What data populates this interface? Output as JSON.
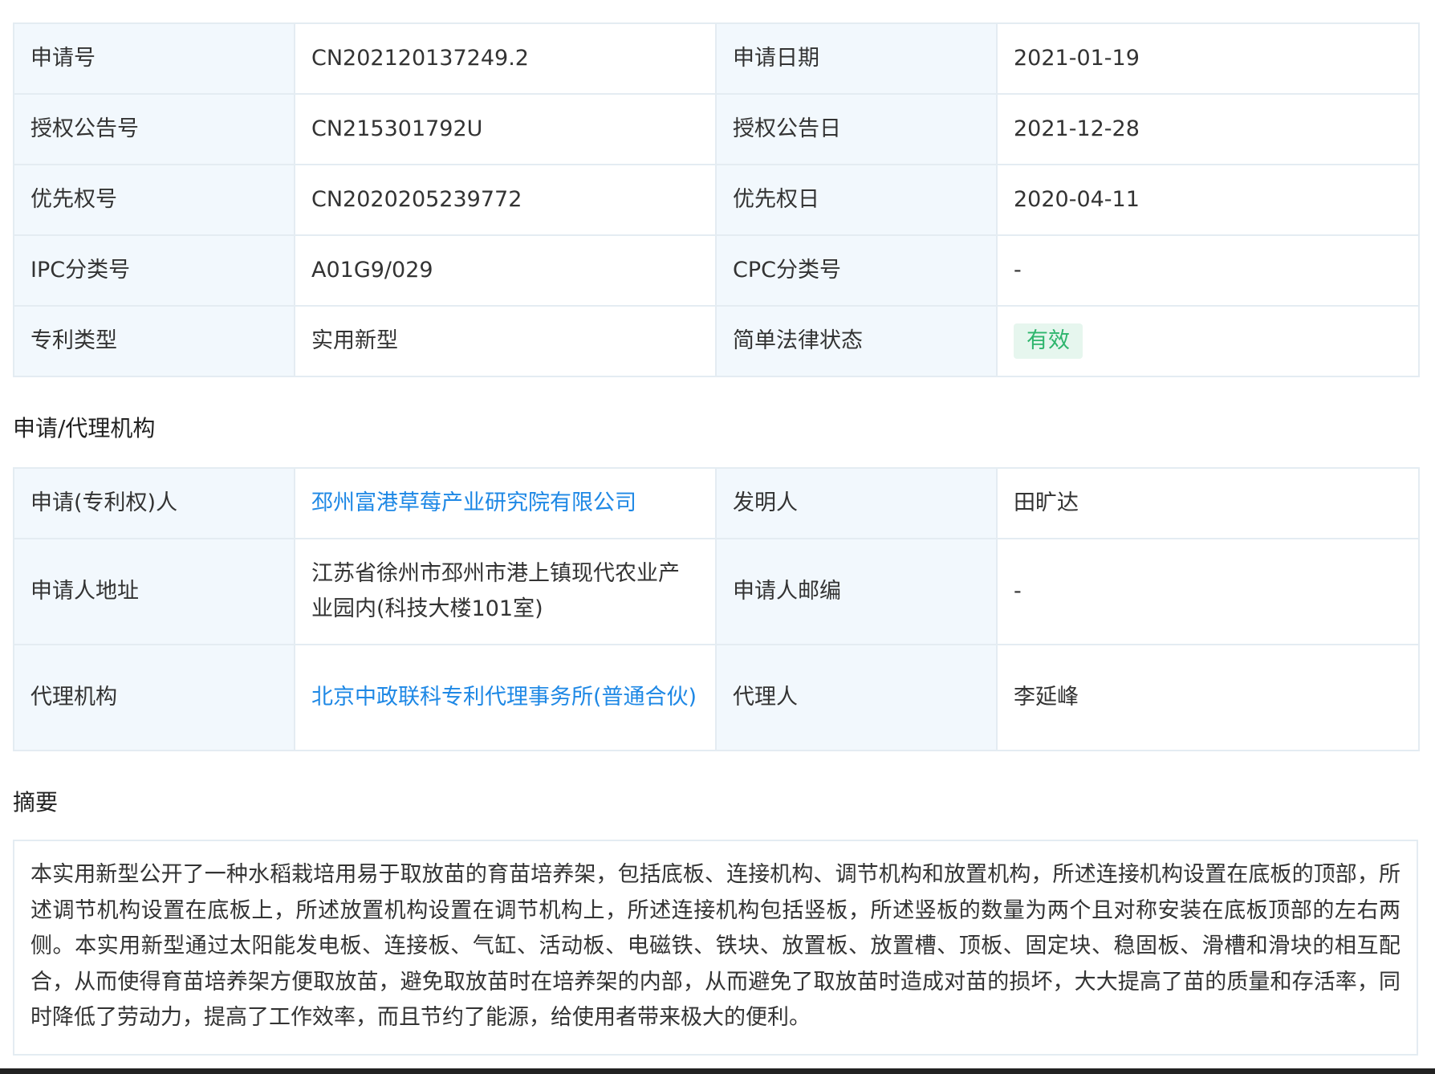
{
  "basic": {
    "rows": [
      {
        "k1": "申请号",
        "v1": "CN202120137249.2",
        "k2": "申请日期",
        "v2": "2021-01-19"
      },
      {
        "k1": "授权公告号",
        "v1": "CN215301792U",
        "k2": "授权公告日",
        "v2": "2021-12-28"
      },
      {
        "k1": "优先权号",
        "v1": "CN2020205239772",
        "k2": "优先权日",
        "v2": "2020-04-11"
      },
      {
        "k1": "IPC分类号",
        "v1": "A01G9/029",
        "k2": "CPC分类号",
        "v2": "-"
      },
      {
        "k1": "专利类型",
        "v1": "实用新型",
        "k2": "简单法律状态",
        "v2": "有效"
      }
    ]
  },
  "agency": {
    "title": "申请/代理机构",
    "rows": [
      {
        "k1": "申请(专利权)人",
        "v1": "邳州富港草莓产业研究院有限公司",
        "k2": "发明人",
        "v2": "田旷达"
      },
      {
        "k1": "申请人地址",
        "v1": "江苏省徐州市邳州市港上镇现代农业产业园内(科技大楼101室)",
        "k2": "申请人邮编",
        "v2": "-"
      },
      {
        "k1": "代理机构",
        "v1": "北京中政联科专利代理事务所(普通合伙)",
        "k2": "代理人",
        "v2": "李延峰"
      }
    ]
  },
  "abstract": {
    "title": "摘要",
    "text": "本实用新型公开了一种水稻栽培用易于取放苗的育苗培养架，包括底板、连接机构、调节机构和放置机构，所述连接机构设置在底板的顶部，所述调节机构设置在底板上，所述放置机构设置在调节机构上，所述连接机构包括竖板，所述竖板的数量为两个且对称安装在底板顶部的左右两侧。本实用新型通过太阳能发电板、连接板、气缸、活动板、电磁铁、铁块、放置板、放置槽、顶板、固定块、稳固板、滑槽和滑块的相互配合，从而使得育苗培养架方便取放苗，避免取放苗时在培养架的内部，从而避免了取放苗时造成对苗的损坏，大大提高了苗的质量和存活率，同时降低了劳动力，提高了工作效率，而且节约了能源，给使用者带来极大的便利。"
  },
  "colors": {
    "label_bg": "#f2f8fd",
    "border": "#e4ecf2",
    "link": "#1e88e5",
    "status_green": "#2eb56d",
    "status_bg": "#e6f6ee"
  }
}
